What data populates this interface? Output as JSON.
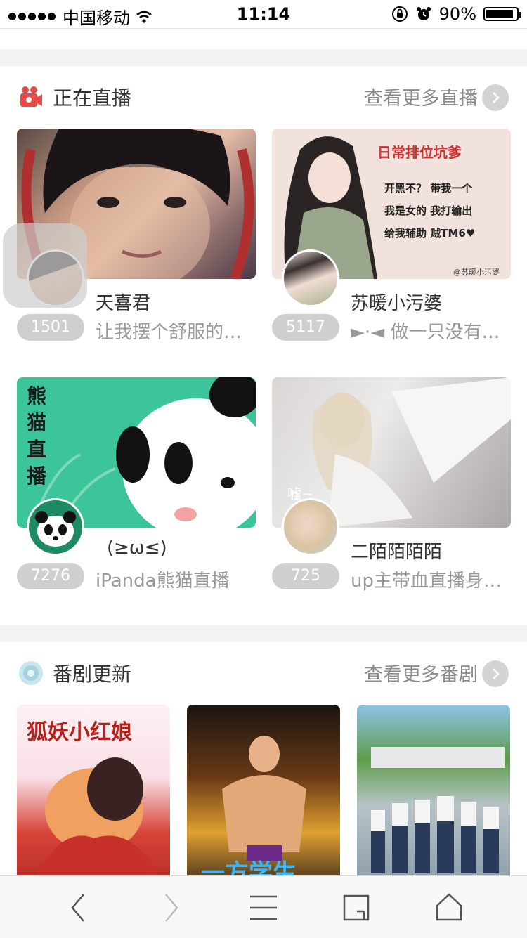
{
  "status_bar": {
    "carrier": "中国移动",
    "time": "11:14",
    "battery": "90%",
    "battery_level": 0.9
  },
  "live_section": {
    "title": "正在直播",
    "more_label": "查看更多直播",
    "icon": "video-camera-icon",
    "accent_color": "#e84a4a",
    "cards": [
      {
        "streamer": "天喜君",
        "viewers": "1501",
        "description": "让我摆个舒服的…",
        "poster_text": []
      },
      {
        "streamer": "苏暖小污婆",
        "viewers": "5117",
        "description": "►·◄ 做一只没有…",
        "poster_text": [
          "日常排位坑爹",
          "开黑不？  带我一个",
          "我是女的  我打输出",
          "给我辅助  贼TM6♥",
          "@苏暖小污婆"
        ]
      },
      {
        "streamer": "(≥ω≤)",
        "viewers": "7276",
        "description": "iPanda熊猫直播",
        "poster_text": [
          "熊猫直播"
        ]
      },
      {
        "streamer": "二陌陌陌陌",
        "viewers": "725",
        "description": "up主带血直播身…",
        "poster_text": [
          "嘘~"
        ]
      }
    ]
  },
  "anime_section": {
    "title": "番剧更新",
    "more_label": "查看更多番剧",
    "icon": "disc-icon",
    "posters": [
      {
        "text": "狐妖小红娘"
      },
      {
        "text": "一方学生"
      },
      {
        "text": ""
      }
    ]
  },
  "toolbar": {
    "items": [
      "back-icon",
      "forward-icon",
      "menu-icon",
      "tabs-icon",
      "home-icon"
    ]
  }
}
